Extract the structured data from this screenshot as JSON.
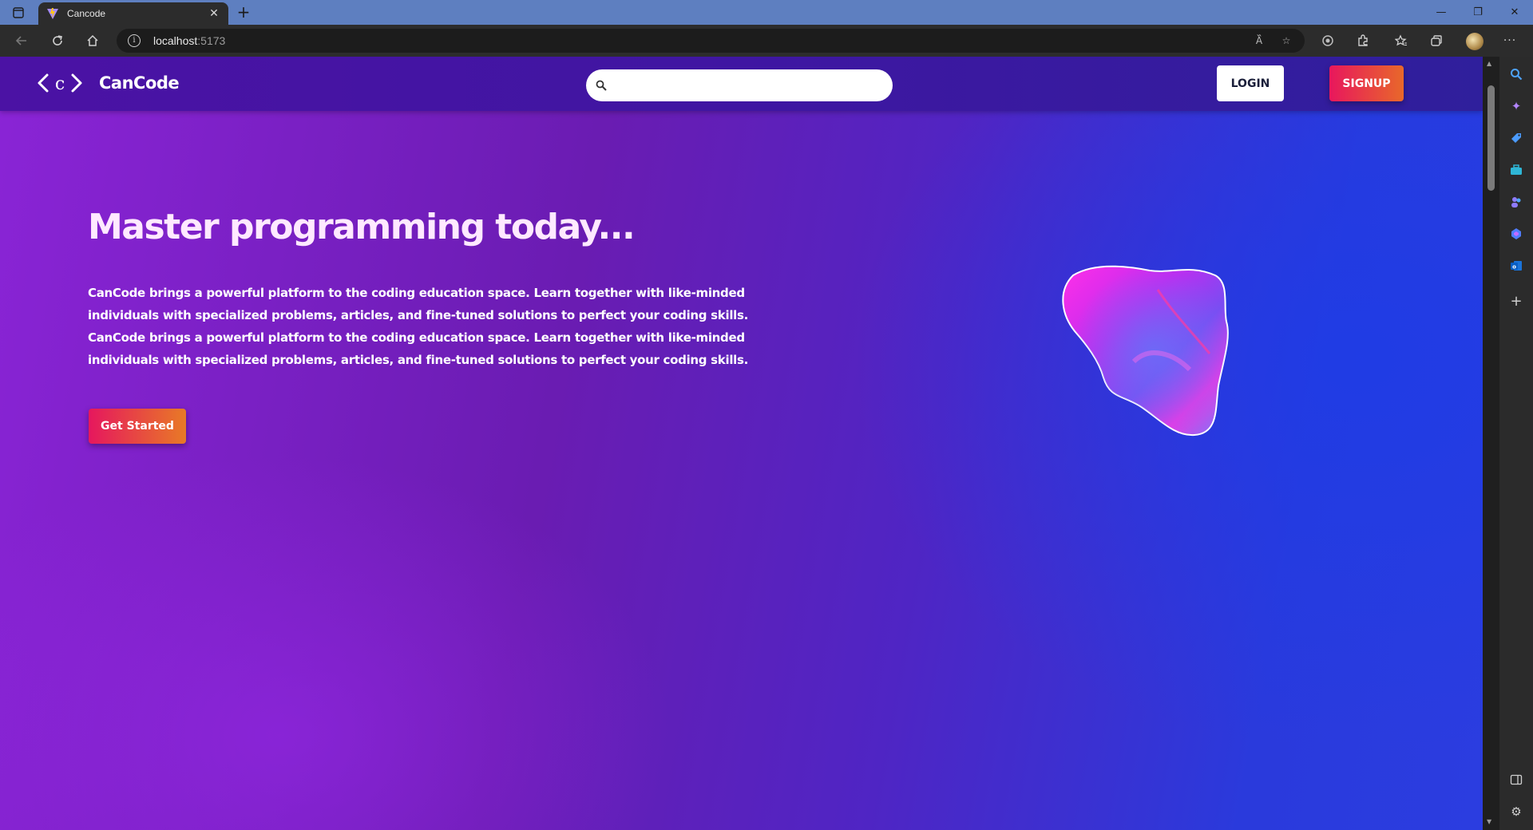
{
  "browser": {
    "tab": {
      "title": "Cancode",
      "close_glyph": "✕"
    },
    "new_tab_glyph": "+",
    "address": {
      "host": "localhost",
      "port": ":5173"
    },
    "window_controls": {
      "minimize": "—",
      "restore": "❐",
      "close": "✕"
    }
  },
  "nav": {
    "logo_text": "CanCode",
    "logo_icon": "code-brackets-c-icon",
    "search": {
      "value": "",
      "placeholder": ""
    },
    "login_label": "LOGIN",
    "signup_label": "SIGNUP"
  },
  "hero": {
    "title": "Master programming today...",
    "paragraph_lines": [
      "CanCode brings a powerful platform to the coding education space. Learn together with like-minded",
      "individuals with specialized problems, articles, and fine-tuned solutions to perfect your coding skills.",
      "CanCode brings a powerful platform to the coding education space. Learn together with like-minded",
      "individuals with specialized problems, articles, and fine-tuned solutions to perfect your coding skills."
    ],
    "cta_label": "Get Started",
    "illustration": "gradient-blob"
  },
  "colors": {
    "titlebar": "#5e7fc0",
    "navbar": "#4b12a4",
    "accent_start": "#e8175d",
    "accent_end": "#e8682a",
    "bg_purple": "#8a24d6",
    "bg_blue": "#2a3adc"
  }
}
